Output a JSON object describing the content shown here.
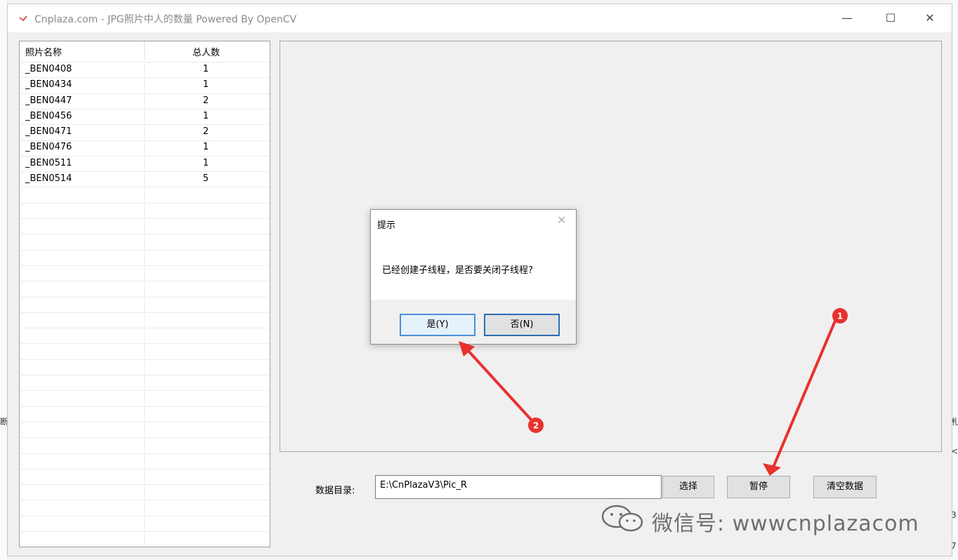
{
  "window": {
    "title": "Cnplaza.com - JPG照片中人的数量  Powered By OpenCV",
    "min_glyph": "—",
    "max_glyph": "☐",
    "close_glyph": "✕"
  },
  "list": {
    "columns": [
      "照片名称",
      "总人数"
    ],
    "rows": [
      {
        "name": "_BEN0408",
        "count": "1"
      },
      {
        "name": "_BEN0434",
        "count": "1"
      },
      {
        "name": "_BEN0447",
        "count": "2"
      },
      {
        "name": "_BEN0456",
        "count": "1"
      },
      {
        "name": "_BEN0471",
        "count": "2"
      },
      {
        "name": "_BEN0476",
        "count": "1"
      },
      {
        "name": "_BEN0511",
        "count": "1"
      },
      {
        "name": "_BEN0514",
        "count": "5"
      }
    ]
  },
  "controls": {
    "dir_label": "数据目录:",
    "dir_value": "E:\\CnPlazaV3\\Pic_R",
    "select_label": "选择",
    "pause_label": "暂停",
    "clear_label": "清空数据"
  },
  "dialog": {
    "title": "提示",
    "message": "已经创建子线程，是否要关闭子线程?",
    "yes_label": "是(Y)",
    "no_label": "否(N)",
    "close_glyph": "✕"
  },
  "annotations": {
    "badge1": "1",
    "badge2": "2",
    "color": "#e8312f"
  },
  "watermark": {
    "text": "微信号: wwwcnplazacom",
    "icon": "wechat-icon"
  },
  "edge_fragments": {
    "left_top": "断",
    "right_top": "札",
    "right_mid": "<",
    "right_row1": "3",
    "right_row2": "7"
  }
}
